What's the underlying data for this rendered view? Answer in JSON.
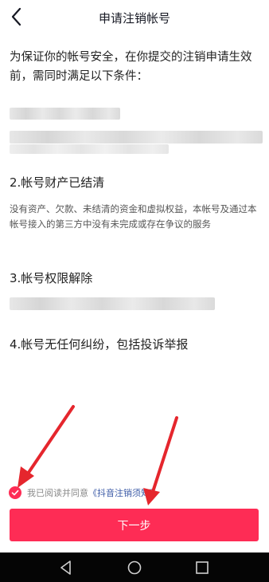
{
  "header": {
    "title": "申请注销帐号",
    "back_icon": "back-chevron-icon"
  },
  "intro": "为保证你的帐号安全，在你提交的注销申请生效前，需同时满足以下条件：",
  "conditions": [
    {
      "title": "2.帐号财产已结清",
      "desc": "没有资产、欠款、未结清的资金和虚拟权益，本帐号及通过本帐号接入的第三方中没有未完成或存在争议的服务"
    },
    {
      "title": "3.帐号权限解除"
    },
    {
      "title": "4.帐号无任何纠纷，包括投诉举报"
    }
  ],
  "agreement": {
    "checked": true,
    "prefix": "我已阅读并同意",
    "link": "《抖音注销须知》"
  },
  "next_button": {
    "label": "下一步"
  },
  "colors": {
    "accent": "#fe2c55",
    "link": "#3b5aa6",
    "annotation_arrow": "#e5262d"
  },
  "navbar": {
    "icons": [
      "nav-back-icon",
      "nav-home-icon",
      "nav-recents-icon"
    ]
  }
}
